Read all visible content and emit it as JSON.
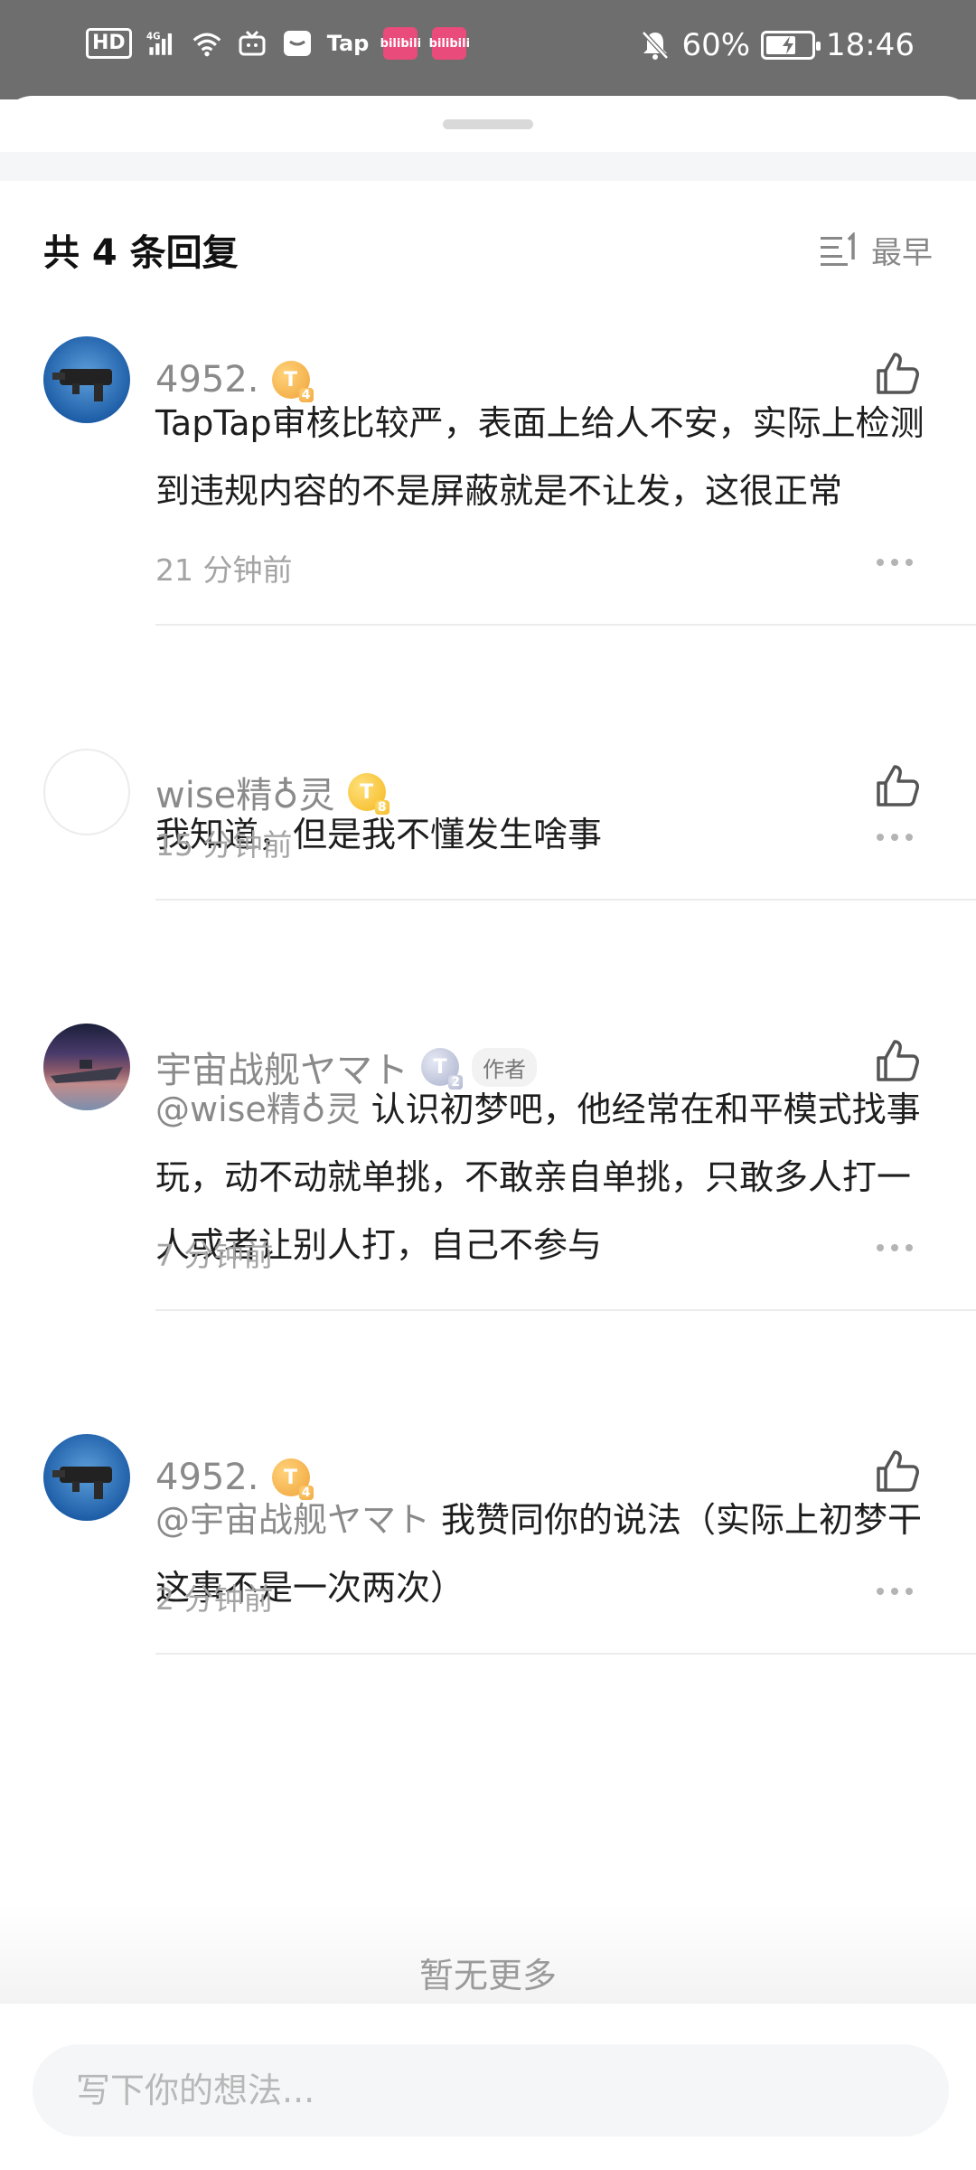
{
  "status_bar": {
    "hd": "HD",
    "network": "4G",
    "tap": "Tap",
    "bili1": "bilibili",
    "bili2": "bilibili",
    "battery": "60%",
    "time": "18:46"
  },
  "header": {
    "title": "共 4 条回复",
    "sort_label": "最早"
  },
  "comments": [
    {
      "name": "4952.",
      "badge_level": "4",
      "text": "TapTap审核比较严，表面上给人不安，实际上检测到违规内容的不是屏蔽就是不让发，这很正常",
      "time": "21 分钟前"
    },
    {
      "name": "wise精♁灵",
      "badge_level": "8",
      "text": "我知道，但是我不懂发生啥事",
      "time": "15 分钟前"
    },
    {
      "name": "宇宙战舰ヤマト",
      "badge_level": "2",
      "author_tag": "作者",
      "mention": "@wise精♁灵",
      "text": "认识初梦吧，他经常在和平模式找事玩，动不动就单挑，不敢亲自单挑，只敢多人打一人或者让别人打，自己不参与",
      "time": "7 分钟前"
    },
    {
      "name": "4952.",
      "badge_level": "4",
      "mention": "@宇宙战舰ヤマト",
      "text": "我赞同你的说法（实际上初梦干这事不是一次两次）",
      "time": "2 分钟前"
    }
  ],
  "footer": {
    "no_more": "暂无更多",
    "input_placeholder": "写下你的想法..."
  },
  "colors": {
    "status_bar_bg": "#6e6e6e",
    "name_gray": "#8a8a8a",
    "badge_gold": "#f0a43a",
    "badge_silver": "#a9b0cc"
  }
}
